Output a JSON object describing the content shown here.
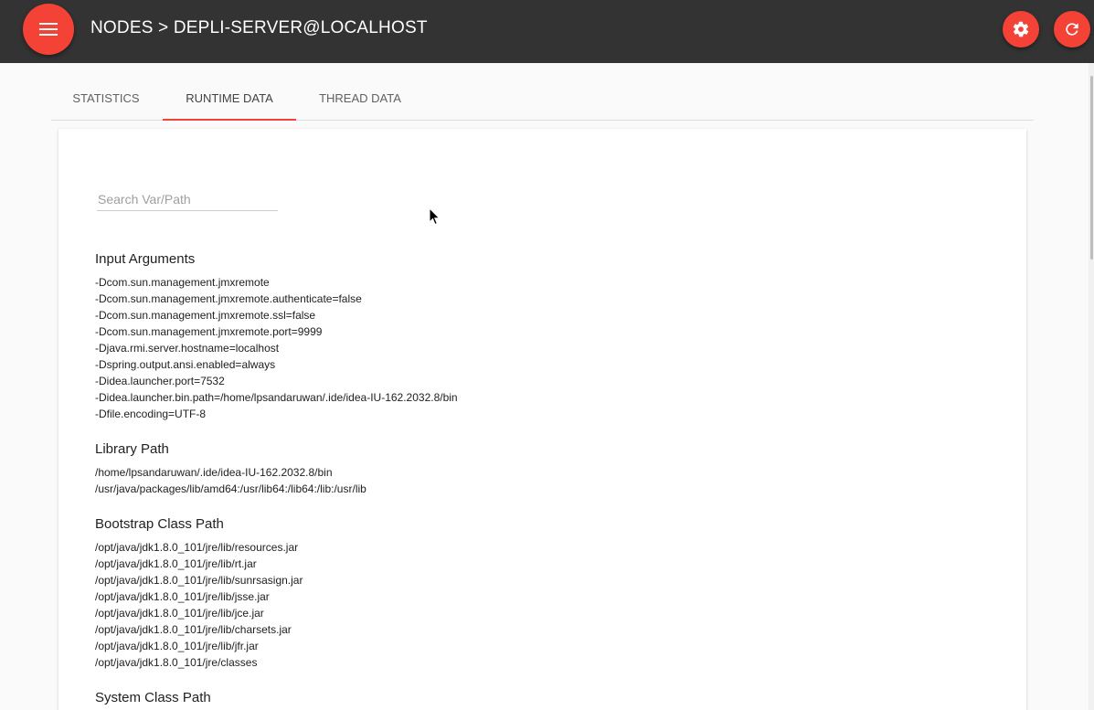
{
  "header": {
    "title": "NODES > DEPLI-SERVER@LOCALHOST",
    "menu_icon": "menu-icon",
    "settings_icon": "gear-icon",
    "refresh_icon": "refresh-icon"
  },
  "colors": {
    "topbar": "#333333",
    "accent": "#f44336"
  },
  "tabs": [
    {
      "label": "STATISTICS",
      "active": false
    },
    {
      "label": "RUNTIME DATA",
      "active": true
    },
    {
      "label": "THREAD DATA",
      "active": false
    }
  ],
  "search": {
    "placeholder": "Search Var/Path",
    "value": ""
  },
  "sections": [
    {
      "title": "Input Arguments",
      "items": [
        "-Dcom.sun.management.jmxremote",
        "-Dcom.sun.management.jmxremote.authenticate=false",
        "-Dcom.sun.management.jmxremote.ssl=false",
        "-Dcom.sun.management.jmxremote.port=9999",
        "-Djava.rmi.server.hostname=localhost",
        "-Dspring.output.ansi.enabled=always",
        "-Didea.launcher.port=7532",
        "-Didea.launcher.bin.path=/home/lpsandaruwan/.ide/idea-IU-162.2032.8/bin",
        "-Dfile.encoding=UTF-8"
      ]
    },
    {
      "title": "Library Path",
      "items": [
        "/home/lpsandaruwan/.ide/idea-IU-162.2032.8/bin",
        "/usr/java/packages/lib/amd64:/usr/lib64:/lib64:/lib:/usr/lib"
      ]
    },
    {
      "title": "Bootstrap Class Path",
      "items": [
        "/opt/java/jdk1.8.0_101/jre/lib/resources.jar",
        "/opt/java/jdk1.8.0_101/jre/lib/rt.jar",
        "/opt/java/jdk1.8.0_101/jre/lib/sunrsasign.jar",
        "/opt/java/jdk1.8.0_101/jre/lib/jsse.jar",
        "/opt/java/jdk1.8.0_101/jre/lib/jce.jar",
        "/opt/java/jdk1.8.0_101/jre/lib/charsets.jar",
        "/opt/java/jdk1.8.0_101/jre/lib/jfr.jar",
        "/opt/java/jdk1.8.0_101/jre/classes"
      ]
    },
    {
      "title": "System Class Path",
      "items": []
    }
  ]
}
